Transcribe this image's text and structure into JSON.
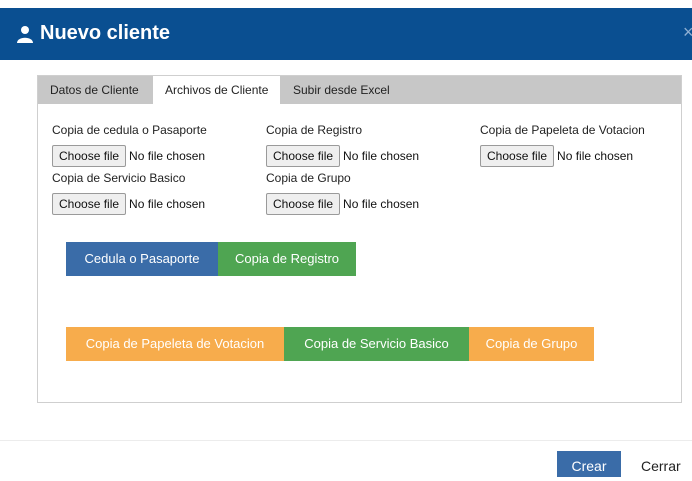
{
  "modal": {
    "title": "Nuevo cliente",
    "close_glyph": "×",
    "icons": {
      "title": "user-icon"
    }
  },
  "tabs": [
    {
      "label": "Datos de Cliente"
    },
    {
      "label": "Archivos de Cliente",
      "active": true
    },
    {
      "label": "Subir desde Excel"
    }
  ],
  "files": [
    {
      "label": "Copia de cedula o Pasaporte",
      "button": "Choose file",
      "status": "No file chosen"
    },
    {
      "label": "Copia de Registro",
      "button": "Choose file",
      "status": "No file chosen"
    },
    {
      "label": "Copia de Papeleta de Votacion",
      "button": "Choose file",
      "status": "No file chosen"
    },
    {
      "label": "Copia de Servicio Basico",
      "button": "Choose file",
      "status": "No file chosen"
    },
    {
      "label": "Copia de Grupo",
      "button": "Choose file",
      "status": "No file chosen"
    }
  ],
  "doc_buttons": [
    {
      "label": "Cedula o Pasaporte",
      "color": "#3a6ca8"
    },
    {
      "label": "Copia de Registro",
      "color": "#4fa552"
    },
    {
      "label": "Copia de Papeleta de Votacion",
      "color": "#f7ac4c"
    },
    {
      "label": "Copia de Servicio Basico",
      "color": "#4fa552"
    },
    {
      "label": "Copia de Grupo",
      "color": "#f7ac4c"
    }
  ],
  "footer": {
    "create_label": "Crear",
    "close_label": "Cerrar"
  },
  "colors": {
    "header": "#0a4f91",
    "primary": "#3a6ca8",
    "success": "#4fa552",
    "warning": "#f7ac4c"
  }
}
